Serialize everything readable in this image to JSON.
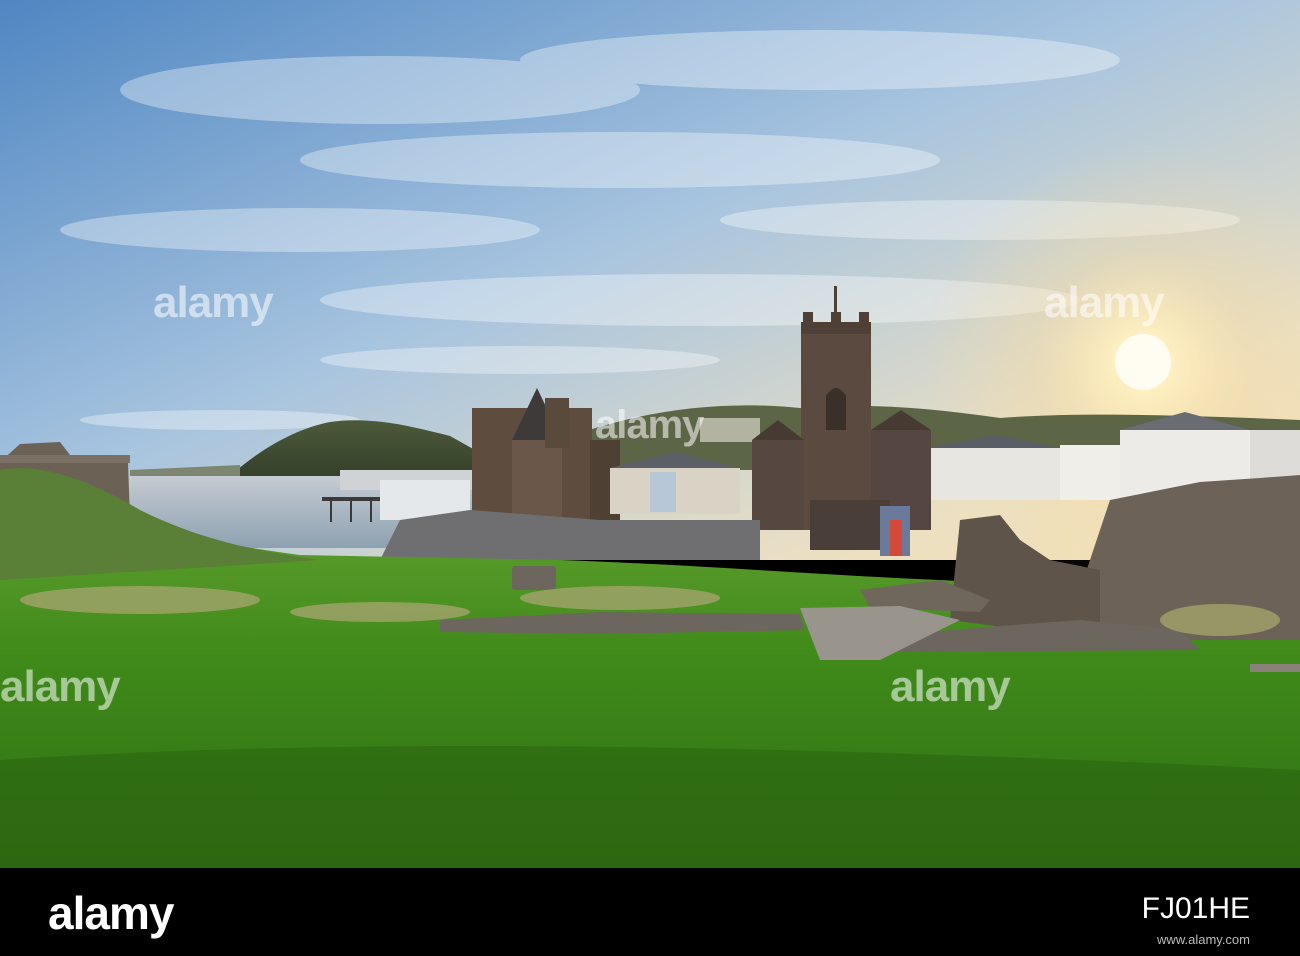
{
  "watermark": {
    "text": "alamy",
    "color": "#ffffff"
  },
  "footer": {
    "brand": "alamy",
    "image_id": "FJ01HE",
    "meta": "www.alamy.com"
  },
  "colors": {
    "sky_top": "#5a8fc9",
    "sky_horizon": "#f4e3b8",
    "sun": "#fff6d4",
    "sea": "#a9b9c6",
    "grass": "#3f8e1f",
    "stone": "#5a5048"
  }
}
